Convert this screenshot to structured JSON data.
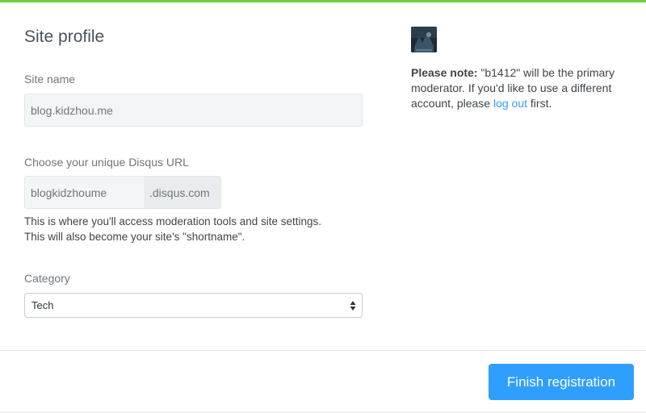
{
  "colors": {
    "accent_bar": "#6bd13c",
    "primary_button": "#2e9fff",
    "link": "#2e9fff"
  },
  "page": {
    "title": "Site profile"
  },
  "form": {
    "site_name": {
      "label": "Site name",
      "value": "blog.kidzhou.me"
    },
    "disqus_url": {
      "label": "Choose your unique Disqus URL",
      "value": "blogkidzhoume",
      "suffix": ".disqus.com",
      "help_line1": "This is where you'll access moderation tools and site settings.",
      "help_line2": "This will also become your site's \"shortname\"."
    },
    "category": {
      "label": "Category",
      "selected": "Tech"
    }
  },
  "sidebar": {
    "avatar_icon": "user-avatar",
    "note_bold": "Please note:",
    "note_text": " \"b1412\" will be the primary moderator. If you'd like to use a different account, please ",
    "logout_link": "log out",
    "note_end": " first."
  },
  "footer": {
    "finish_label": "Finish registration"
  }
}
